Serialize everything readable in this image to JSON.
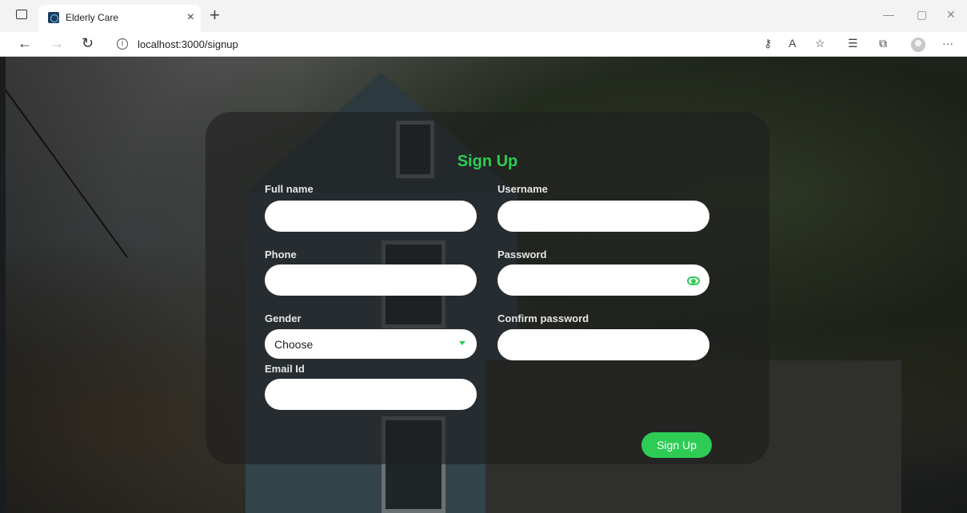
{
  "browser": {
    "tab_title": "Elderly Care",
    "tab_close": "×",
    "new_tab": "+",
    "url": "localhost:3000/signup",
    "win_min": "—",
    "win_max": "▢",
    "win_close": "✕",
    "more": "···"
  },
  "form": {
    "title": "Sign Up",
    "fields": {
      "full_name": {
        "label": "Full name",
        "value": ""
      },
      "username": {
        "label": "Username",
        "value": ""
      },
      "phone": {
        "label": "Phone",
        "value": ""
      },
      "password": {
        "label": "Password",
        "value": ""
      },
      "gender": {
        "label": "Gender",
        "value": "Choose"
      },
      "confirm_password": {
        "label": "Confirm password",
        "value": ""
      },
      "email": {
        "label": "Email Id",
        "value": ""
      }
    },
    "submit_label": "Sign Up"
  },
  "colors": {
    "accent": "#2ecc55"
  }
}
